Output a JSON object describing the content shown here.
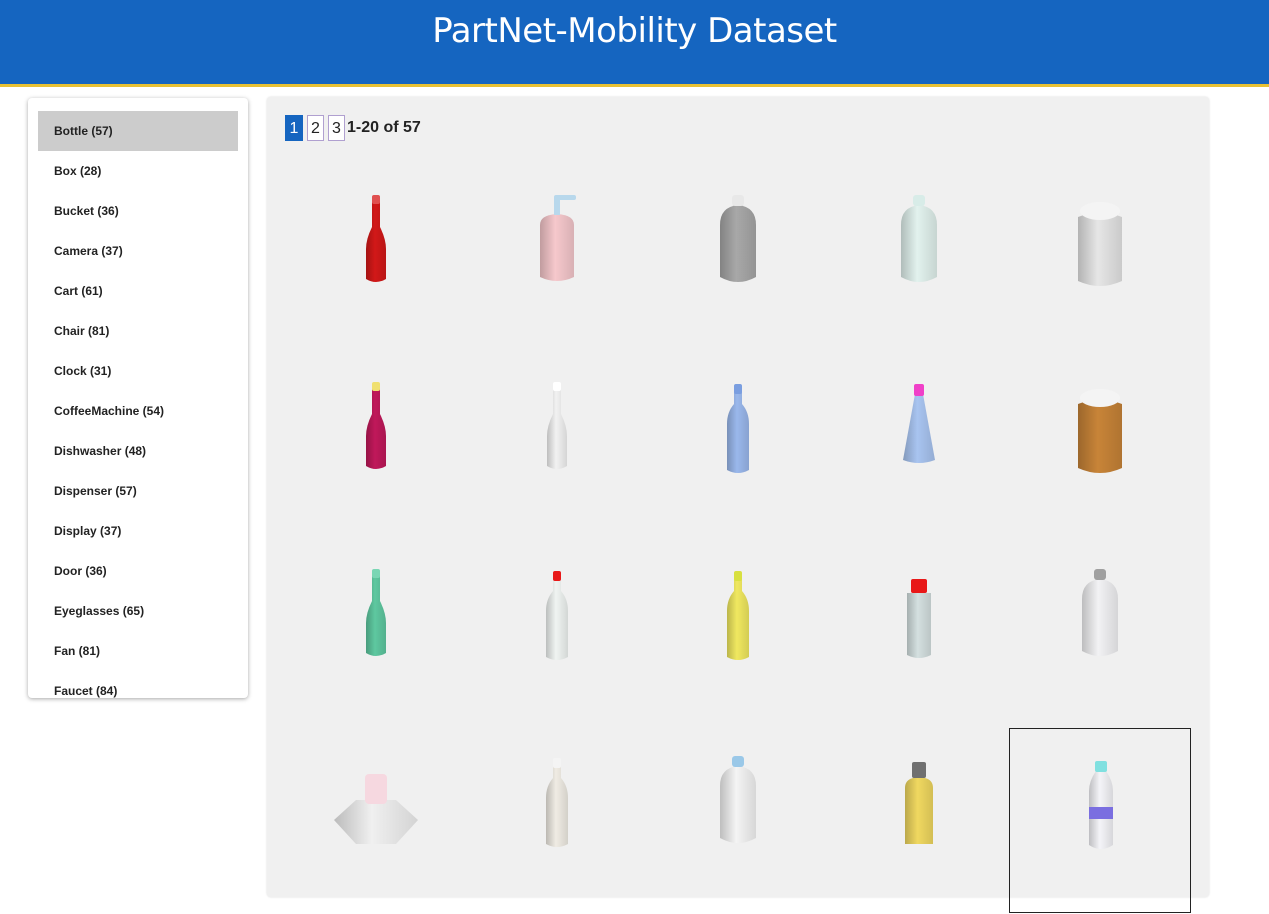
{
  "header": {
    "title": "PartNet-Mobility Dataset"
  },
  "sidebar": {
    "items": [
      {
        "label": "Bottle (57)"
      },
      {
        "label": "Box (28)"
      },
      {
        "label": "Bucket (36)"
      },
      {
        "label": "Camera (37)"
      },
      {
        "label": "Cart (61)"
      },
      {
        "label": "Chair (81)"
      },
      {
        "label": "Clock (31)"
      },
      {
        "label": "CoffeeMachine (54)"
      },
      {
        "label": "Dishwasher (48)"
      },
      {
        "label": "Dispenser (57)"
      },
      {
        "label": "Display (37)"
      },
      {
        "label": "Door (36)"
      },
      {
        "label": "Eyeglasses (65)"
      },
      {
        "label": "Fan (81)"
      },
      {
        "label": "Faucet (84)"
      }
    ],
    "active": "Bottle (57)"
  },
  "pager": {
    "pages": [
      "1",
      "2",
      "3"
    ],
    "current": "1",
    "range": "1-20 of 57"
  },
  "models": [
    {
      "name": "red-wine-bottle",
      "body": "#d21818",
      "cap": "#e05050",
      "shape": "wine"
    },
    {
      "name": "pink-pump-bottle",
      "body": "#f6c8cc",
      "cap": "#b8d8ec",
      "shape": "pump"
    },
    {
      "name": "grey-jug",
      "body": "#a8a8a8",
      "cap": "#e8e8e8",
      "shape": "jug"
    },
    {
      "name": "white-jug-handle",
      "body": "#e2f2ee",
      "cap": "#d8ece8",
      "shape": "jug"
    },
    {
      "name": "white-jar",
      "body": "#e6e6e6",
      "cap": "#f4f4f4",
      "shape": "jar"
    },
    {
      "name": "magenta-bottle",
      "body": "#c0185a",
      "cap": "#f0e070",
      "shape": "wine"
    },
    {
      "name": "white-tall-bottle",
      "body": "#f2f2f2",
      "cap": "#ffffff",
      "shape": "wine"
    },
    {
      "name": "blue-bottle",
      "body": "#9ab8ec",
      "cap": "#7a9ee0",
      "shape": "tall"
    },
    {
      "name": "blue-cone-bottle",
      "body": "#a8c4f0",
      "cap": "#f040c8",
      "shape": "cone"
    },
    {
      "name": "pill-jar",
      "body": "#c88438",
      "cap": "#f4f4f4",
      "shape": "jar"
    },
    {
      "name": "mint-bottle",
      "body": "#5ec8a0",
      "cap": "#7ad6b4",
      "shape": "wine"
    },
    {
      "name": "white-red-cap-bottle",
      "body": "#f0f4f2",
      "cap": "#e81818",
      "shape": "tall"
    },
    {
      "name": "yellow-bottle",
      "body": "#f0e860",
      "cap": "#d8e040",
      "shape": "tall"
    },
    {
      "name": "spray-bottle",
      "body": "#d4e0e0",
      "cap": "#e81818",
      "shape": "spray"
    },
    {
      "name": "white-grey-cap-bottle",
      "body": "#f2f2f4",
      "cap": "#a0a0a0",
      "shape": "jug"
    },
    {
      "name": "hexagon-base-bottle",
      "body": "#f0f0f0",
      "cap": "#f6d8e0",
      "shape": "hex"
    },
    {
      "name": "white-dropper-bottle",
      "body": "#f0ece4",
      "cap": "#f4f4f4",
      "shape": "tall"
    },
    {
      "name": "milk-bottle",
      "body": "#f4f4f4",
      "cap": "#9ac8e8",
      "shape": "jug"
    },
    {
      "name": "yellow-mouthwash-bottle",
      "body": "#f0d860",
      "cap": "#707070",
      "shape": "flask"
    },
    {
      "name": "water-bottle",
      "body": "#f4f4f8",
      "cap": "#80e0e0",
      "shape": "water"
    }
  ],
  "selected_model": 19
}
